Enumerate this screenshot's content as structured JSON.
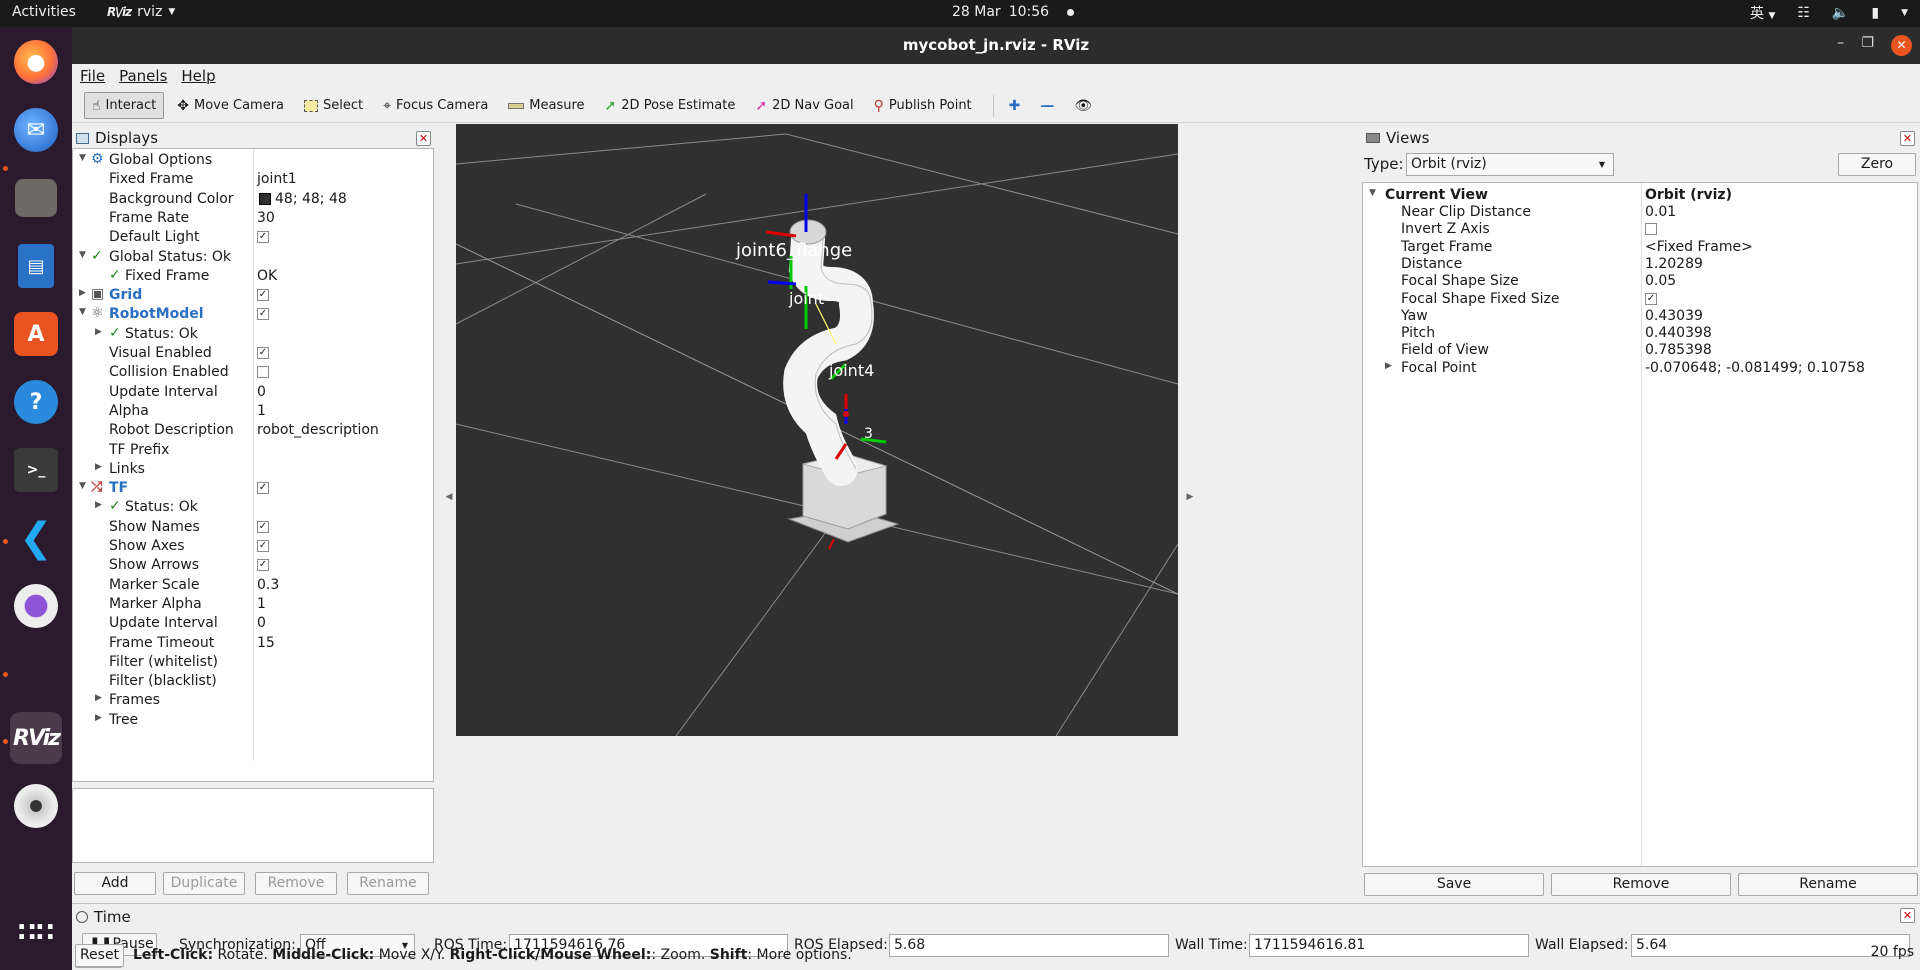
{
  "topbar": {
    "activities": "Activities",
    "app_logo": "R\\/iz",
    "app_name": "rviz",
    "date": "28 Mar",
    "time": "10:56",
    "input_method": "英"
  },
  "dock": {
    "items": [
      "firefox-icon",
      "thunderbird-icon",
      "files-icon",
      "writer-icon",
      "app-center-icon",
      "help-icon",
      "terminal-icon",
      "vscode-icon",
      "cheese-icon",
      "rviz-icon",
      "dvd-icon",
      "app-grid-icon"
    ]
  },
  "window": {
    "title": "mycobot_jn.rviz - RViz"
  },
  "menu": {
    "file": "File",
    "panels": "Panels",
    "help": "Help"
  },
  "toolbar": {
    "interact": "Interact",
    "move_camera": "Move Camera",
    "select": "Select",
    "focus_camera": "Focus Camera",
    "measure": "Measure",
    "pose_estimate": "2D Pose Estimate",
    "nav_goal": "2D Nav Goal",
    "publish_point": "Publish Point"
  },
  "displays": {
    "title": "Displays",
    "rows": [
      {
        "label": "Global Options",
        "value": "",
        "indent": 0,
        "arrow": "down",
        "icon": "gear",
        "check": "",
        "style": ""
      },
      {
        "label": "Fixed Frame",
        "value": "joint1",
        "indent": 1,
        "arrow": "",
        "icon": "",
        "check": "",
        "style": ""
      },
      {
        "label": "Background Color",
        "value": "48; 48; 48",
        "indent": 1,
        "arrow": "",
        "icon": "",
        "check": "",
        "style": "swatch"
      },
      {
        "label": "Frame Rate",
        "value": "30",
        "indent": 1,
        "arrow": "",
        "icon": "",
        "check": "",
        "style": ""
      },
      {
        "label": "Default Light",
        "value": "",
        "indent": 1,
        "arrow": "",
        "icon": "",
        "check": "on",
        "style": ""
      },
      {
        "label": "Global Status: Ok",
        "value": "",
        "indent": 0,
        "arrow": "down",
        "icon": "ok",
        "check": "",
        "style": ""
      },
      {
        "label": "Fixed Frame",
        "value": "OK",
        "indent": 1,
        "arrow": "",
        "icon": "ok",
        "check": "",
        "style": ""
      },
      {
        "label": "Grid",
        "value": "",
        "indent": 0,
        "arrow": "right",
        "icon": "grid",
        "check": "on",
        "style": "blue"
      },
      {
        "label": "RobotModel",
        "value": "",
        "indent": 0,
        "arrow": "down",
        "icon": "robot",
        "check": "on",
        "style": "blue"
      },
      {
        "label": "Status: Ok",
        "value": "",
        "indent": 1,
        "arrow": "right",
        "icon": "ok",
        "check": "",
        "style": ""
      },
      {
        "label": "Visual Enabled",
        "value": "",
        "indent": 1,
        "arrow": "",
        "icon": "",
        "check": "on",
        "style": ""
      },
      {
        "label": "Collision Enabled",
        "value": "",
        "indent": 1,
        "arrow": "",
        "icon": "",
        "check": "off",
        "style": ""
      },
      {
        "label": "Update Interval",
        "value": "0",
        "indent": 1,
        "arrow": "",
        "icon": "",
        "check": "",
        "style": ""
      },
      {
        "label": "Alpha",
        "value": "1",
        "indent": 1,
        "arrow": "",
        "icon": "",
        "check": "",
        "style": ""
      },
      {
        "label": "Robot Description",
        "value": "robot_description",
        "indent": 1,
        "arrow": "",
        "icon": "",
        "check": "",
        "style": ""
      },
      {
        "label": "TF Prefix",
        "value": "",
        "indent": 1,
        "arrow": "",
        "icon": "",
        "check": "",
        "style": ""
      },
      {
        "label": "Links",
        "value": "",
        "indent": 1,
        "arrow": "right",
        "icon": "",
        "check": "",
        "style": ""
      },
      {
        "label": "TF",
        "value": "",
        "indent": 0,
        "arrow": "down",
        "icon": "tf",
        "check": "on",
        "style": "blue"
      },
      {
        "label": "Status: Ok",
        "value": "",
        "indent": 1,
        "arrow": "right",
        "icon": "ok",
        "check": "",
        "style": ""
      },
      {
        "label": "Show Names",
        "value": "",
        "indent": 1,
        "arrow": "",
        "icon": "",
        "check": "on",
        "style": ""
      },
      {
        "label": "Show Axes",
        "value": "",
        "indent": 1,
        "arrow": "",
        "icon": "",
        "check": "on",
        "style": ""
      },
      {
        "label": "Show Arrows",
        "value": "",
        "indent": 1,
        "arrow": "",
        "icon": "",
        "check": "on",
        "style": ""
      },
      {
        "label": "Marker Scale",
        "value": "0.3",
        "indent": 1,
        "arrow": "",
        "icon": "",
        "check": "",
        "style": ""
      },
      {
        "label": "Marker Alpha",
        "value": "1",
        "indent": 1,
        "arrow": "",
        "icon": "",
        "check": "",
        "style": ""
      },
      {
        "label": "Update Interval",
        "value": "0",
        "indent": 1,
        "arrow": "",
        "icon": "",
        "check": "",
        "style": ""
      },
      {
        "label": "Frame Timeout",
        "value": "15",
        "indent": 1,
        "arrow": "",
        "icon": "",
        "check": "",
        "style": ""
      },
      {
        "label": "Filter (whitelist)",
        "value": "",
        "indent": 1,
        "arrow": "",
        "icon": "",
        "check": "",
        "style": ""
      },
      {
        "label": "Filter (blacklist)",
        "value": "",
        "indent": 1,
        "arrow": "",
        "icon": "",
        "check": "",
        "style": ""
      },
      {
        "label": "Frames",
        "value": "",
        "indent": 1,
        "arrow": "right",
        "icon": "",
        "check": "",
        "style": ""
      },
      {
        "label": "Tree",
        "value": "",
        "indent": 1,
        "arrow": "right",
        "icon": "",
        "check": "",
        "style": ""
      }
    ],
    "buttons": {
      "add": "Add",
      "duplicate": "Duplicate",
      "remove": "Remove",
      "rename": "Rename"
    }
  },
  "scene": {
    "labels": [
      "joint6_flange",
      "joint",
      "joint4",
      "3"
    ]
  },
  "views": {
    "title": "Views",
    "type_label": "Type:",
    "type_value": "Orbit (rviz)",
    "zero": "Zero",
    "header_label": "Current View",
    "header_value": "Orbit (rviz)",
    "rows": [
      {
        "label": "Near Clip Distance",
        "value": "0.01",
        "check": "",
        "arrow": ""
      },
      {
        "label": "Invert Z Axis",
        "value": "",
        "check": "off",
        "arrow": ""
      },
      {
        "label": "Target Frame",
        "value": "<Fixed Frame>",
        "check": "",
        "arrow": ""
      },
      {
        "label": "Distance",
        "value": "1.20289",
        "check": "",
        "arrow": ""
      },
      {
        "label": "Focal Shape Size",
        "value": "0.05",
        "check": "",
        "arrow": ""
      },
      {
        "label": "Focal Shape Fixed Size",
        "value": "",
        "check": "on",
        "arrow": ""
      },
      {
        "label": "Yaw",
        "value": "0.43039",
        "check": "",
        "arrow": ""
      },
      {
        "label": "Pitch",
        "value": "0.440398",
        "check": "",
        "arrow": ""
      },
      {
        "label": "Field of View",
        "value": "0.785398",
        "check": "",
        "arrow": ""
      },
      {
        "label": "Focal Point",
        "value": "-0.070648; -0.081499; 0.10758",
        "check": "",
        "arrow": "right"
      }
    ],
    "buttons": {
      "save": "Save",
      "remove": "Remove",
      "rename": "Rename"
    }
  },
  "time": {
    "title": "Time",
    "pause": "Pause",
    "sync_label": "Synchronization:",
    "sync_value": "Off",
    "ros_time_label": "ROS Time:",
    "ros_time": "1711594616.76",
    "ros_elapsed_label": "ROS Elapsed:",
    "ros_elapsed": "5.68",
    "wall_time_label": "Wall Time:",
    "wall_time": "1711594616.81",
    "wall_elapsed_label": "Wall Elapsed:",
    "wall_elapsed": "5.64"
  },
  "status": {
    "reset": "Reset",
    "left_click": "Left-Click:",
    "rotate": " Rotate. ",
    "middle_click": "Middle-Click:",
    "move": " Move X/Y. ",
    "right_click": "Right-Click/Mouse Wheel:",
    "zoom": ": Zoom. ",
    "shift": "Shift",
    "more": ": More options.",
    "fps": "20 fps"
  },
  "colors": {
    "accent": "#e95420",
    "grid_bg": "#303030",
    "link_blue": "#2a6fc4"
  }
}
